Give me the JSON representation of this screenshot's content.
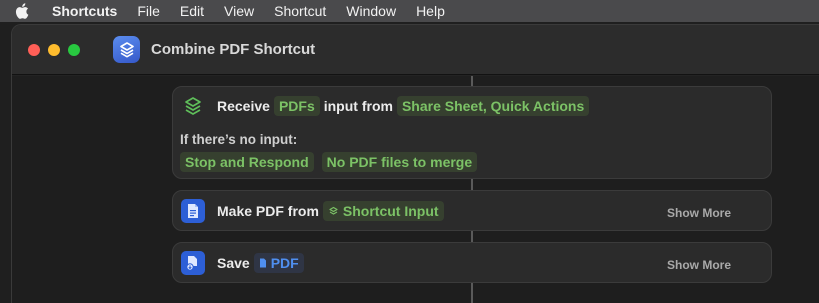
{
  "menubar": {
    "app_name": "Shortcuts",
    "items": [
      "File",
      "Edit",
      "View",
      "Shortcut",
      "Window",
      "Help"
    ]
  },
  "window": {
    "title": "Combine PDF Shortcut",
    "icon": "shortcuts-app-icon"
  },
  "actions": {
    "receive": {
      "label": "Receive",
      "type_token": "PDFs",
      "middle_text": "input from",
      "source_token": "Share Sheet, Quick Actions",
      "no_input_heading": "If there’s no input:",
      "behavior_token": "Stop and Respond",
      "message_token": "No PDF files to merge"
    },
    "make_pdf": {
      "label": "Make PDF from",
      "input_token": "Shortcut Input",
      "show_more": "Show More"
    },
    "save": {
      "label": "Save",
      "input_token": "PDF",
      "show_more": "Show More"
    }
  },
  "colors": {
    "token_green": "#7cc266",
    "token_blue": "#4f8ff0",
    "accent_blue": "#2d5fd6"
  }
}
